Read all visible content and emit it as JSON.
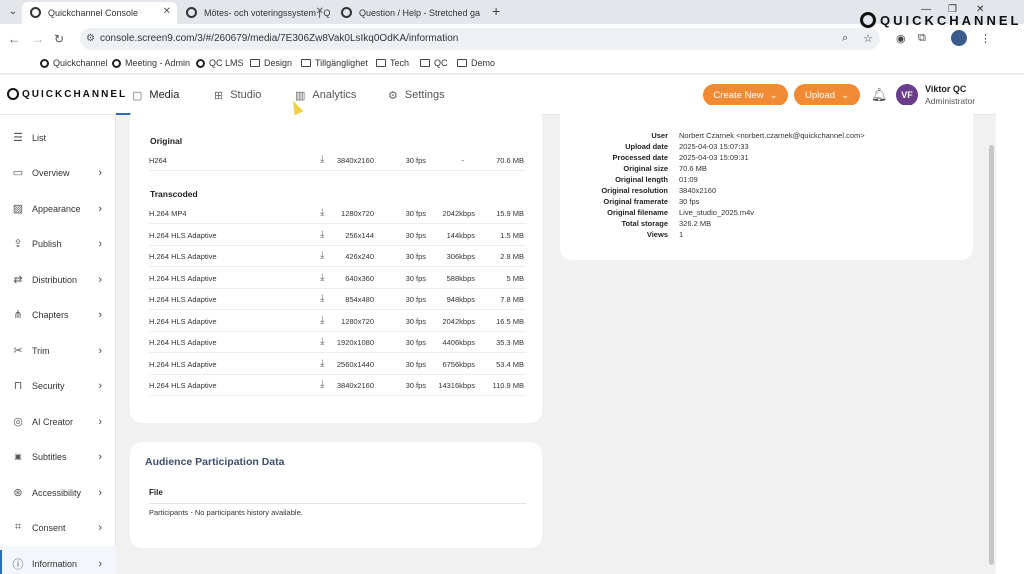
{
  "browser": {
    "tabs": [
      {
        "title": "Quickchannel Console"
      },
      {
        "title": "Mötes- och voteringssystem | Q"
      },
      {
        "title": "Question / Help - Stretched ga"
      }
    ],
    "url": "console.screen9.com/3/#/260679/media/7E306Zw8Vak0LsIkq0OdKA/information",
    "bookmarks": [
      "Quickchannel",
      "Meeting - Admin",
      "QC LMS",
      "Design",
      "Tillgänglighet",
      "Tech",
      "QC",
      "Demo"
    ]
  },
  "brand": {
    "name": "QUICKCHANNEL"
  },
  "header": {
    "nav": [
      {
        "label": "Media",
        "icon": "media-icon"
      },
      {
        "label": "Studio",
        "icon": "studio-icon"
      },
      {
        "label": "Analytics",
        "icon": "chart-icon"
      },
      {
        "label": "Settings",
        "icon": "gear-icon"
      }
    ],
    "create_label": "Create New",
    "upload_label": "Upload",
    "user": {
      "initials": "VF",
      "name": "Viktor QC",
      "role": "Administrator"
    }
  },
  "sidebar": {
    "items": [
      {
        "label": "List",
        "icon": "list-icon"
      },
      {
        "label": "Overview",
        "icon": "monitor-icon"
      },
      {
        "label": "Appearance",
        "icon": "image-icon"
      },
      {
        "label": "Publish",
        "icon": "upload-icon"
      },
      {
        "label": "Distribution",
        "icon": "share-icon"
      },
      {
        "label": "Chapters",
        "icon": "chapters-icon"
      },
      {
        "label": "Trim",
        "icon": "scissors-icon"
      },
      {
        "label": "Security",
        "icon": "lock-icon"
      },
      {
        "label": "AI Creator",
        "icon": "ai-icon"
      },
      {
        "label": "Subtitles",
        "icon": "cc-icon"
      },
      {
        "label": "Accessibility",
        "icon": "accessibility-icon"
      },
      {
        "label": "Consent",
        "icon": "consent-icon"
      },
      {
        "label": "Information",
        "icon": "info-icon"
      }
    ]
  },
  "files": {
    "original_label": "Original",
    "original": [
      {
        "name": "H264",
        "res": "3840x2160",
        "fps": "30 fps",
        "kbps": "-",
        "size": "70.6 MB"
      }
    ],
    "transcoded_label": "Transcoded",
    "transcoded": [
      {
        "name": "H.264 MP4",
        "res": "1280x720",
        "fps": "30 fps",
        "kbps": "2042kbps",
        "size": "15.9 MB"
      },
      {
        "name": "H.264 HLS Adaptive",
        "res": "256x144",
        "fps": "30 fps",
        "kbps": "144kbps",
        "size": "1.5 MB"
      },
      {
        "name": "H.264 HLS Adaptive",
        "res": "426x240",
        "fps": "30 fps",
        "kbps": "306kbps",
        "size": "2.8 MB"
      },
      {
        "name": "H.264 HLS Adaptive",
        "res": "640x360",
        "fps": "30 fps",
        "kbps": "588kbps",
        "size": "5 MB"
      },
      {
        "name": "H.264 HLS Adaptive",
        "res": "854x480",
        "fps": "30 fps",
        "kbps": "948kbps",
        "size": "7.8 MB"
      },
      {
        "name": "H.264 HLS Adaptive",
        "res": "1280x720",
        "fps": "30 fps",
        "kbps": "2042kbps",
        "size": "16.5 MB"
      },
      {
        "name": "H.264 HLS Adaptive",
        "res": "1920x1080",
        "fps": "30 fps",
        "kbps": "4406kbps",
        "size": "35.3 MB"
      },
      {
        "name": "H.264 HLS Adaptive",
        "res": "2560x1440",
        "fps": "30 fps",
        "kbps": "6756kbps",
        "size": "53.4 MB"
      },
      {
        "name": "H.264 HLS Adaptive",
        "res": "3840x2160",
        "fps": "30 fps",
        "kbps": "14316kbps",
        "size": "110.9 MB"
      }
    ]
  },
  "meta": [
    {
      "k": "User",
      "v": "Norbert Czarnek <norbert.czarnek@quickchannel.com>"
    },
    {
      "k": "Upload date",
      "v": "2025-04-03 15:07:33"
    },
    {
      "k": "Processed date",
      "v": "2025-04-03 15:09:31"
    },
    {
      "k": "Original size",
      "v": "70.6 MB"
    },
    {
      "k": "Original length",
      "v": "01:09"
    },
    {
      "k": "Original resolution",
      "v": "3840x2160"
    },
    {
      "k": "Original framerate",
      "v": "30 fps"
    },
    {
      "k": "Original filename",
      "v": "Live_studio_2025.m4v"
    },
    {
      "k": "Total storage",
      "v": "326.2 MB"
    },
    {
      "k": "Views",
      "v": "1"
    }
  ],
  "audience": {
    "title": "Audience Participation Data",
    "file_header": "File",
    "empty_message": "Participants - No participants history available."
  }
}
